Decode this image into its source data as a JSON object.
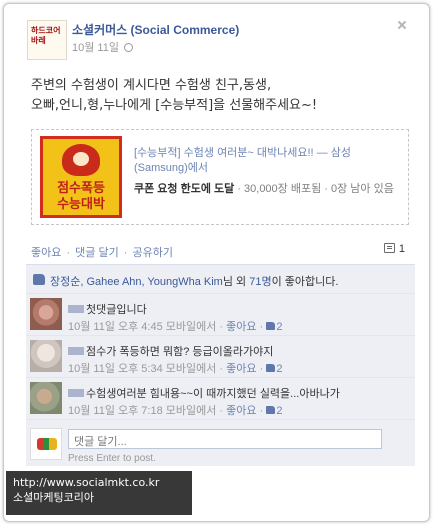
{
  "post": {
    "page_name": "소셜커머스 (Social Commerce)",
    "time": "10월 11일",
    "avatar_text": "하드코어 바레",
    "message_line1": "주변의 수험생이 계시다면 수험생 친구,동생,",
    "message_line2": "오빠,언니,형,누나에게 [수능부적]을 선물해주세요~!"
  },
  "share": {
    "image_line1": "점수폭등",
    "image_line2": "수능대박",
    "title": "[수능부적] 수험생 여러분~ 대박나세요!! — 삼성(Samsung)에서",
    "desc_bold": "쿠폰 요청 한도에 도달",
    "desc_rest": " · 30,000장 배포됨 · 0장 남아 있음"
  },
  "actions": {
    "like": "좋아요",
    "comment": "댓글 달기",
    "share": "공유하기",
    "comment_count": "1",
    "separator": "·"
  },
  "likes": {
    "names": "장정순, Gahee Ahn, YoungWha Kim",
    "middle": "님 외 ",
    "others": "71명",
    "suffix": "이 좋아합니다."
  },
  "comments": [
    {
      "text": "첫댓글입니다",
      "time": "10월 11일 오후 4:45 모바일에서",
      "like_label": "좋아요",
      "like_count": "2"
    },
    {
      "text": "점수가 폭등하면 뭐함? 등급이올라가야지",
      "time": "10월 11일 오후 5:34 모바일에서",
      "like_label": "좋아요",
      "like_count": "2"
    },
    {
      "text": "수험생여러분 힘내용~~이 때까지했던 실력을...아바나가",
      "time": "10월 11일 오후 7:18 모바일에서",
      "like_label": "좋아요",
      "like_count": "2"
    }
  ],
  "compose": {
    "placeholder": "댓글 달기...",
    "hint": "Press Enter to post."
  },
  "watermark": {
    "url": "http://www.socialmkt.co.kr",
    "label": "소셜마케팅코리아"
  },
  "colors": {
    "link": "#3b5998",
    "ufi_background": "#edeff4",
    "card_image_bg": "#f3c218",
    "card_image_border": "#d22d1c"
  }
}
